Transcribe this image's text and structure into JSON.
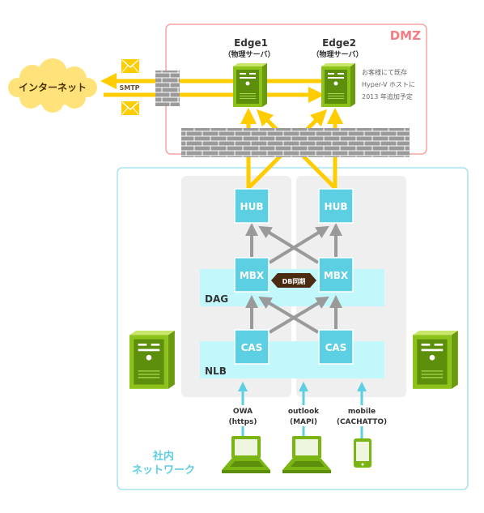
{
  "colors": {
    "dmz_border": "#f7a3a3",
    "dmz_label": "#f47c84",
    "internal_border": "#a6e3ee",
    "node_fill": "#5ccfe2",
    "band_fill": "#c2f8fc",
    "column_fill": "#efefef",
    "yellow": "#ffcc00",
    "cloud": "#ffe37a",
    "gray_arrow": "#9a9a9a",
    "sync_badge": "#4a2a10",
    "server_green": "#8cc21a",
    "client_arrow": "#5ccfe2"
  },
  "dmz": {
    "label": "DMZ"
  },
  "internet": {
    "label": "インターネット"
  },
  "smtp": {
    "label": "SMTP"
  },
  "edge1": {
    "name": "Edge1",
    "sub": "（物理サーバ）"
  },
  "edge2": {
    "name": "Edge2",
    "sub": "（物理サーバ）"
  },
  "note": {
    "lines": [
      "お客様にて既存",
      "Hyper-V ホストに",
      "2013 年追加予定"
    ]
  },
  "nodes": {
    "hub": "HUB",
    "mbx": "MBX",
    "cas": "CAS"
  },
  "bands": {
    "dag": "DAG",
    "nlb": "NLB"
  },
  "sync": {
    "label": "DB同期"
  },
  "clients": [
    {
      "line1": "OWA",
      "line2": "(https)",
      "icon": "laptop-icon"
    },
    {
      "line1": "outlook",
      "line2": "(MAPI)",
      "icon": "laptop-icon"
    },
    {
      "line1": "mobile",
      "line2": "(CACHATTO)",
      "icon": "smartphone-icon"
    }
  ],
  "internal": {
    "line1": "社内",
    "line2": "ネットワーク"
  }
}
